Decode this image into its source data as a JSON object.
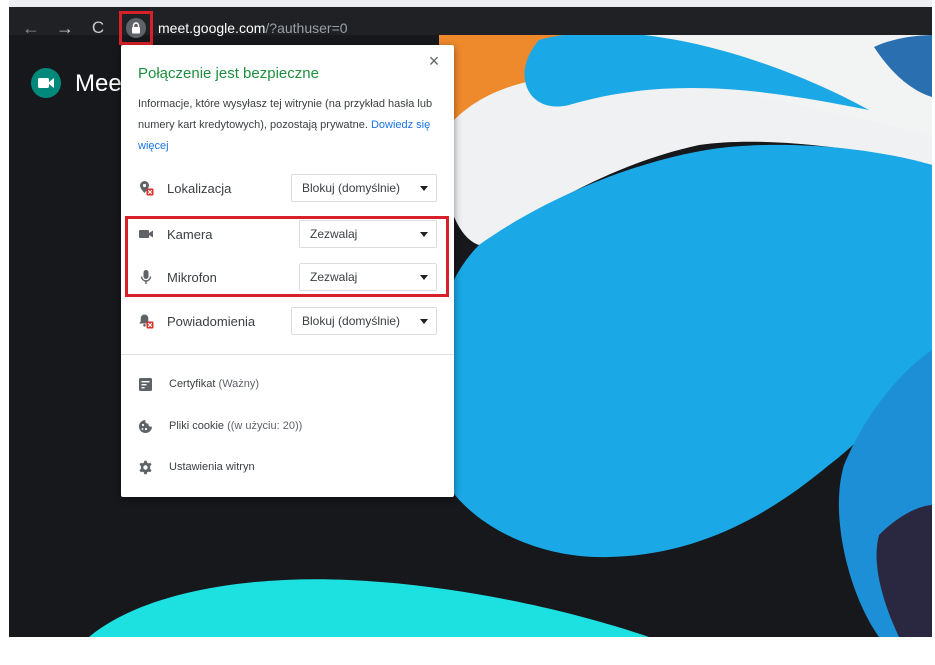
{
  "browser": {
    "url_host": "meet.google.com",
    "url_path": "/?authuser=0",
    "nav_back": "←",
    "nav_forward": "→",
    "nav_reload": "C"
  },
  "page": {
    "app_name": "Meet"
  },
  "popup": {
    "close": "×",
    "title": "Połączenie jest bezpieczne",
    "description": "Informacje, które wysyłasz tej witrynie (na przykład hasła lub numery kart kredytowych), pozostają prywatne.",
    "learn_more": "Dowiedz się więcej",
    "permissions": [
      {
        "label": "Lokalizacja",
        "value": "Blokuj (domyślnie)",
        "icon": "location-blocked-icon"
      },
      {
        "label": "Kamera",
        "value": "Zezwalaj",
        "icon": "camera-icon"
      },
      {
        "label": "Mikrofon",
        "value": "Zezwalaj",
        "icon": "microphone-icon"
      },
      {
        "label": "Powiadomienia",
        "value": "Blokuj (domyślnie)",
        "icon": "notifications-blocked-icon"
      }
    ],
    "links": [
      {
        "label": "Certyfikat",
        "sub": "(Ważny)",
        "icon": "certificate-icon"
      },
      {
        "label": "Pliki cookie",
        "sub": "((w użyciu: 20))",
        "icon": "cookie-icon"
      },
      {
        "label": "Ustawienia witryn",
        "sub": "",
        "icon": "gear-icon"
      }
    ]
  },
  "colors": {
    "highlight": "#d8202a",
    "secure_title": "#1e8e3e",
    "link": "#1a73e8",
    "toolbar": "#202124"
  }
}
